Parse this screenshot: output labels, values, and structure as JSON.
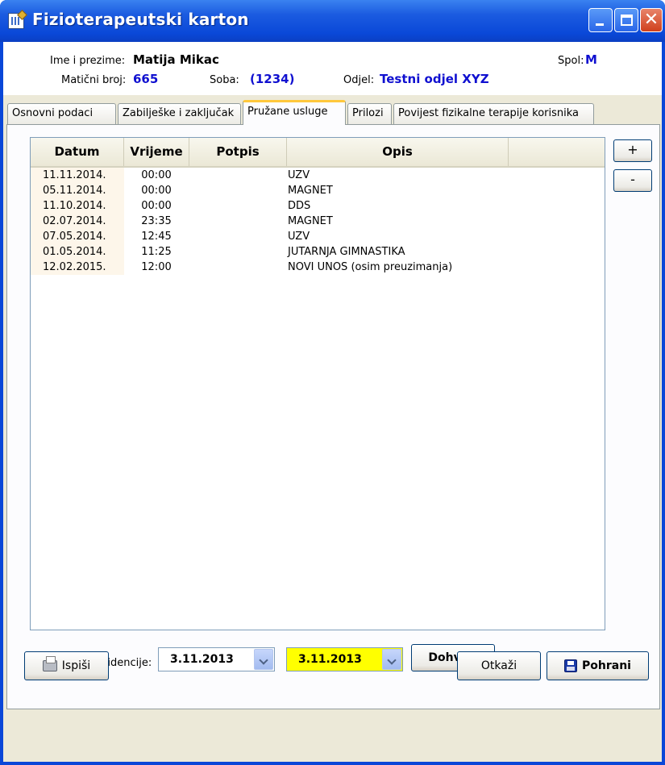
{
  "window": {
    "title": "Fizioterapeutski karton"
  },
  "header": {
    "name_label": "Ime i prezime:",
    "name_value": "Matija Mikac",
    "id_label": "Matični broj:",
    "id_value": "665",
    "room_label": "Soba:",
    "room_value": "(1234)",
    "dept_label": "Odjel:",
    "dept_value": "Testni odjel XYZ",
    "sex_label": "Spol:",
    "sex_value": "M"
  },
  "tabs": [
    {
      "label": "Osnovni podaci"
    },
    {
      "label": "Zabilješke i zaključak"
    },
    {
      "label": "Pružane usluge"
    },
    {
      "label": "Prilozi"
    },
    {
      "label": "Povijest fizikalne terapije korisnika"
    }
  ],
  "table": {
    "columns": [
      "Datum",
      "Vrijeme",
      "Potpis",
      "Opis"
    ],
    "rows": [
      {
        "date": "11.11.2014.",
        "time": "00:00",
        "signature": "",
        "desc": "UZV"
      },
      {
        "date": "05.11.2014.",
        "time": "00:00",
        "signature": "",
        "desc": "MAGNET"
      },
      {
        "date": "11.10.2014.",
        "time": "00:00",
        "signature": "",
        "desc": "DDS"
      },
      {
        "date": "02.07.2014.",
        "time": "23:35",
        "signature": "",
        "desc": "MAGNET"
      },
      {
        "date": "07.05.2014.",
        "time": "12:45",
        "signature": "",
        "desc": "UZV"
      },
      {
        "date": "01.05.2014.",
        "time": "11:25",
        "signature": "",
        "desc": "JUTARNJA GIMNASTIKA"
      },
      {
        "date": "12.02.2015.",
        "time": "12:00",
        "signature": "",
        "desc": "NOVI UNOS (osim preuzimanja)"
      }
    ]
  },
  "side_buttons": {
    "add_label": "+",
    "remove_label": "-"
  },
  "fetch": {
    "label": "Preuzmi iz evidencije:",
    "from_value": "3.11.2013",
    "to_value": "3.11.2013",
    "button_label": "Dohvati"
  },
  "footer": {
    "print_label": "Ispiši",
    "cancel_label": "Otkaži",
    "save_label": "Pohrani"
  },
  "colors": {
    "titlebar": "#0a48d8",
    "value_text": "#1010d0",
    "active_tab_accent": "#ffc83c",
    "date_highlight": "#ffff00"
  }
}
